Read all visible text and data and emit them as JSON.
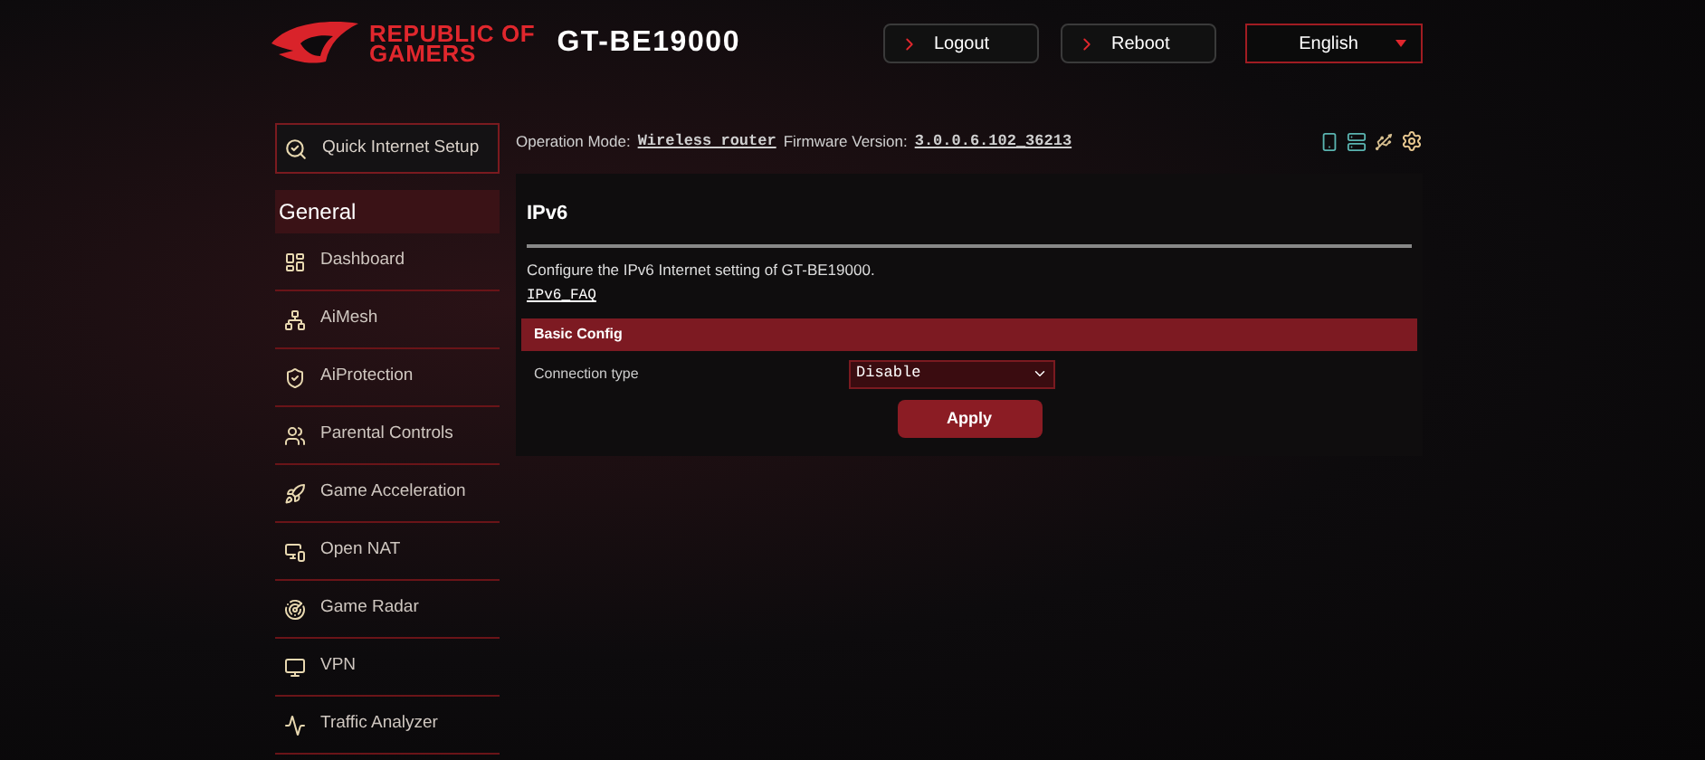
{
  "header": {
    "brand_line_1": "REPUBLIC OF",
    "brand_line_2": "GAMERS",
    "model": "GT-BE19000",
    "buttons": [
      {
        "label": "Logout"
      },
      {
        "label": "Reboot"
      }
    ],
    "language": "English"
  },
  "sidebar": {
    "quick_setup": "Quick Internet Setup",
    "section": "General",
    "items": [
      {
        "label": "Dashboard"
      },
      {
        "label": "AiMesh"
      },
      {
        "label": "AiProtection"
      },
      {
        "label": "Parental Controls"
      },
      {
        "label": "Game Acceleration"
      },
      {
        "label": "Open NAT"
      },
      {
        "label": "Game Radar"
      },
      {
        "label": "VPN"
      },
      {
        "label": "Traffic Analyzer"
      }
    ]
  },
  "status": {
    "mode_label": "Operation Mode:",
    "mode": "Wireless router",
    "firmware_label": "Firmware Version:",
    "firmware": "3.0.0.6.102_36213"
  },
  "page": {
    "title": "IPv6",
    "description": "Configure the IPv6 Internet setting of GT-BE19000.",
    "faq_link": "IPv6_FAQ",
    "section": "Basic Config",
    "fields": [
      {
        "label": "Connection type",
        "value": "Disable"
      }
    ],
    "apply": "Apply"
  }
}
